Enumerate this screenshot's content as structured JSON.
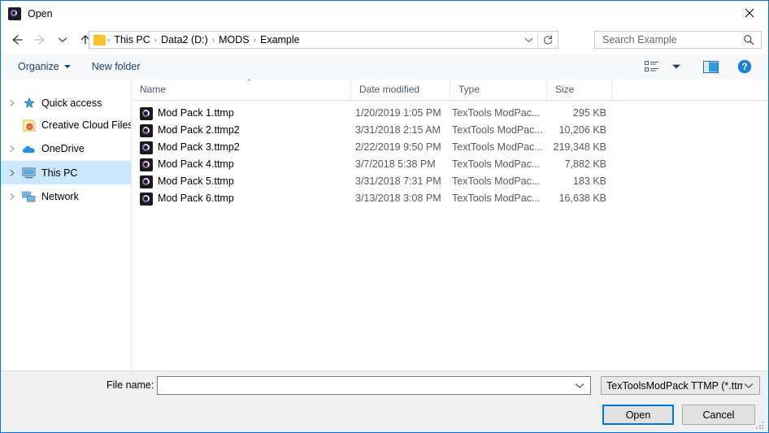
{
  "window": {
    "title": "Open",
    "title_icon": "app-icon",
    "close_label": "✕"
  },
  "nav": {
    "back_icon": "back-arrow-icon",
    "forward_icon": "forward-arrow-icon",
    "recent_icon": "chevron-down-icon",
    "up_icon": "up-arrow-icon",
    "breadcrumbs": [
      "This PC",
      "Data2 (D:)",
      "MODS",
      "Example"
    ],
    "separator": "›",
    "dropdown_icon": "chevron-down-icon",
    "refresh_icon": "refresh-icon"
  },
  "search": {
    "placeholder": "Search Example",
    "value": "",
    "icon": "search-icon"
  },
  "toolbar": {
    "organize_label": "Organize",
    "new_folder_label": "New folder",
    "view_icon": "list-view-icon",
    "view_caret_icon": "chevron-down-icon",
    "preview_pane_icon": "preview-pane-icon",
    "help_icon": "help-icon"
  },
  "sidebar": {
    "items": [
      {
        "label": "Quick access",
        "icon": "star-icon",
        "expander": true,
        "selected": false
      },
      {
        "label": "Creative Cloud Files",
        "icon": "creative-cloud-icon",
        "expander": false,
        "selected": false
      },
      {
        "label": "OneDrive",
        "icon": "cloud-icon",
        "expander": true,
        "selected": false
      },
      {
        "label": "This PC",
        "icon": "monitor-icon",
        "expander": true,
        "selected": true
      },
      {
        "label": "Network",
        "icon": "network-icon",
        "expander": true,
        "selected": false
      }
    ]
  },
  "filelist": {
    "columns": [
      "Name",
      "Date modified",
      "Type",
      "Size"
    ],
    "sort_column": "Name",
    "sort_caret": "⌃",
    "rows": [
      {
        "name": "Mod Pack 1.ttmp",
        "date": "1/20/2019 1:05 PM",
        "type": "TexTools ModPac...",
        "size": "295 KB"
      },
      {
        "name": "Mod Pack 2.ttmp2",
        "date": "3/31/2018 2:15 AM",
        "type": "TextTools ModPac...",
        "size": "10,206 KB"
      },
      {
        "name": "Mod Pack 3.ttmp2",
        "date": "2/22/2019 9:50 PM",
        "type": "TextTools ModPac...",
        "size": "219,348 KB"
      },
      {
        "name": "Mod Pack 4.ttmp",
        "date": "3/7/2018 5:38 PM",
        "type": "TexTools ModPac...",
        "size": "7,882 KB"
      },
      {
        "name": "Mod Pack 5.ttmp",
        "date": "3/31/2018 7:31 PM",
        "type": "TexTools ModPac...",
        "size": "183 KB"
      },
      {
        "name": "Mod Pack 6.ttmp",
        "date": "3/13/2018 3:08 PM",
        "type": "TexTools ModPac...",
        "size": "16,638 KB"
      }
    ]
  },
  "bottom": {
    "filename_label": "File name:",
    "filename_value": "",
    "filename_placeholder": "",
    "filter_value": "TexToolsModPack TTMP (*.ttm",
    "open_label": "Open",
    "cancel_label": "Cancel"
  },
  "colors": {
    "accent": "#0078d7",
    "selection": "#cce8ff",
    "toolbar_link": "#17426b",
    "column_header": "#4a5a72"
  }
}
